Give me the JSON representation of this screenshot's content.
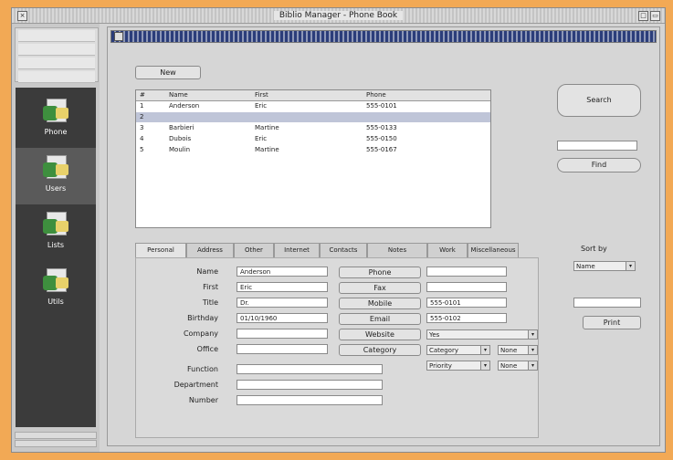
{
  "window": {
    "title": "Biblio Manager - Phone Book"
  },
  "sidebar": {
    "items": [
      {
        "label": "Phone"
      },
      {
        "label": "Users"
      },
      {
        "label": "Lists"
      },
      {
        "label": "Utils"
      }
    ]
  },
  "toolbar": {
    "new_label": "New"
  },
  "table": {
    "headers": [
      "#",
      "Name",
      "First",
      "Phone"
    ],
    "rows": [
      {
        "num": "1",
        "name": "Anderson",
        "first": "Eric",
        "phone": "555-0101"
      },
      {
        "num": "2",
        "name": "",
        "first": "",
        "phone": ""
      },
      {
        "num": "3",
        "name": "Barbieri",
        "first": "Martine",
        "phone": "555-0133"
      },
      {
        "num": "4",
        "name": "Dubois",
        "first": "Eric",
        "phone": "555-0150"
      },
      {
        "num": "5",
        "name": "Moulin",
        "first": "Martine",
        "phone": "555-0167"
      }
    ]
  },
  "tabs": [
    "Personal",
    "Address",
    "Other",
    "Internet",
    "Contacts",
    "Notes",
    "Work",
    "Miscellaneous"
  ],
  "form": {
    "left_labels": [
      "Name",
      "First",
      "Title",
      "Birthday",
      "Company",
      "Office",
      "Function",
      "Department",
      "Number"
    ],
    "left_values": [
      "Anderson",
      "Eric",
      "Dr.",
      "01/10/1960",
      "",
      "",
      "",
      "",
      ""
    ],
    "mid_labels": [
      "Phone",
      "Fax",
      "Mobile",
      "Email",
      "Website",
      "Category"
    ],
    "mid_values": [
      "",
      "",
      "555-0101",
      "555-0102",
      "",
      ""
    ],
    "selects": [
      {
        "value": "Yes"
      },
      {
        "value": "Category"
      },
      {
        "value": "None"
      },
      {
        "value": "Priority"
      },
      {
        "value": "None"
      }
    ]
  },
  "right": {
    "search_label": "Search",
    "find_label": "Find",
    "sort_label": "Sort by",
    "sort_value": "Name",
    "print_label": "Print"
  }
}
